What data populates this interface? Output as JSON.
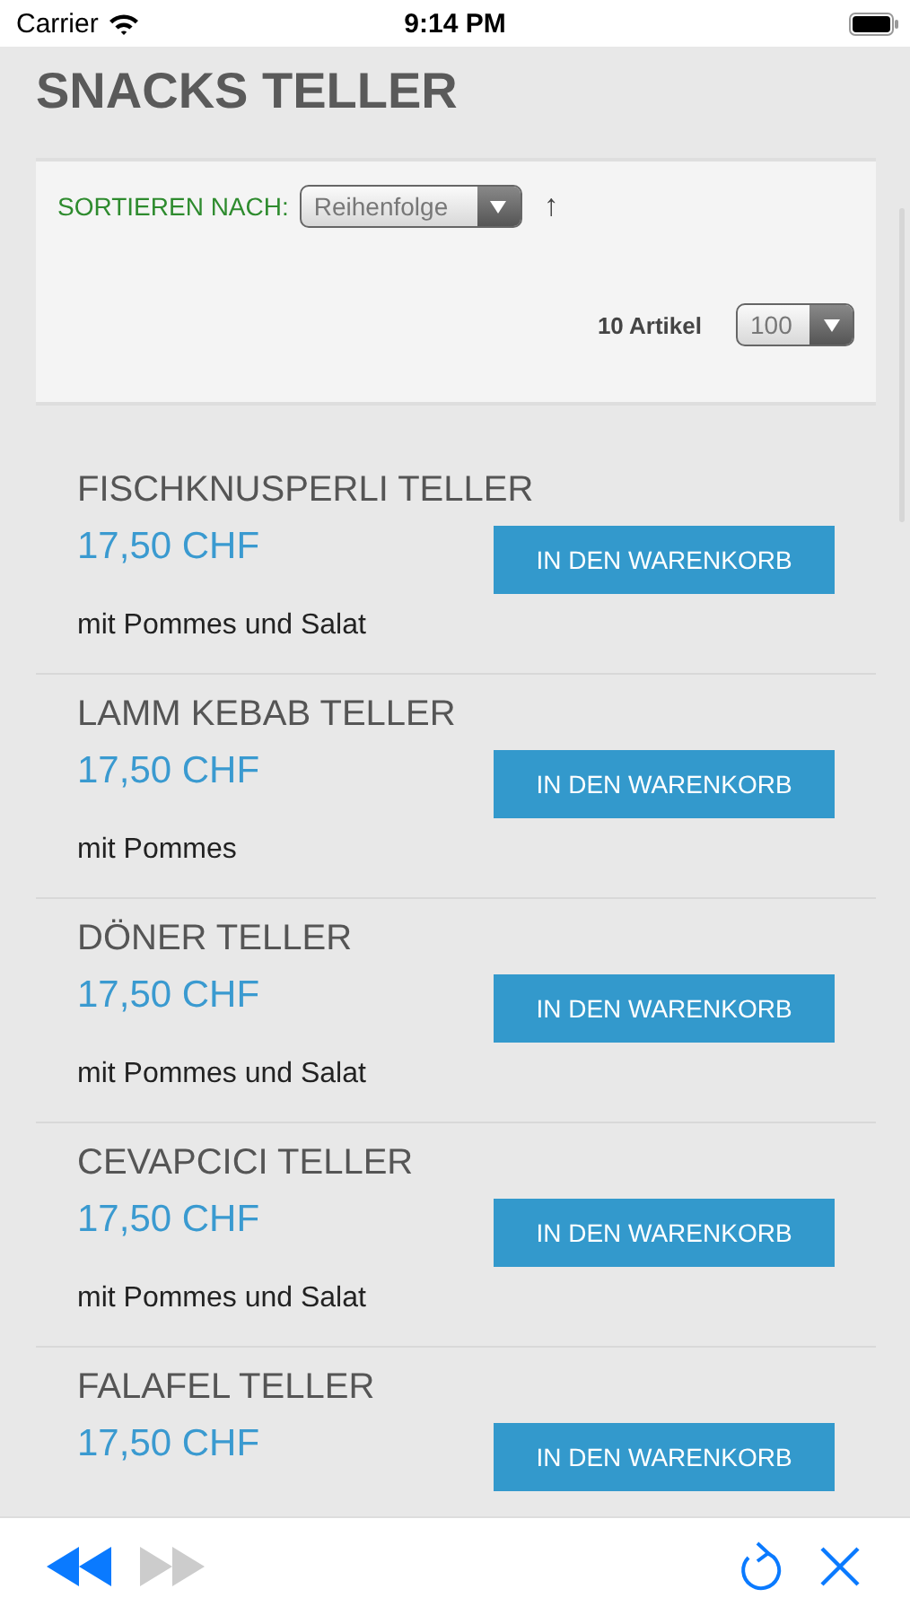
{
  "status_bar": {
    "carrier": "Carrier",
    "time": "9:14 PM"
  },
  "page": {
    "title": "SNACKS TELLER"
  },
  "toolbar": {
    "sort_label": "SORTIEREN NACH:",
    "sort_select": "Reihenfolge",
    "sort_direction": "↑",
    "count": "10 Artikel",
    "per_page_select": "100"
  },
  "products": [
    {
      "name": "FISCHKNUSPERLI TELLER",
      "price": "17,50 CHF",
      "button": "IN DEN WARENKORB",
      "description": "mit Pommes und Salat"
    },
    {
      "name": "LAMM KEBAB TELLER",
      "price": "17,50 CHF",
      "button": "IN DEN WARENKORB",
      "description": "mit Pommes"
    },
    {
      "name": "DÖNER TELLER",
      "price": "17,50 CHF",
      "button": "IN DEN WARENKORB",
      "description": "mit Pommes und Salat"
    },
    {
      "name": "CEVAPCICI TELLER",
      "price": "17,50 CHF",
      "button": "IN DEN WARENKORB",
      "description": "mit Pommes und Salat"
    },
    {
      "name": "FALAFEL TELLER",
      "price": "17,50 CHF",
      "button": "IN DEN WARENKORB"
    }
  ],
  "browser_toolbar": {
    "back": {
      "disabled": false
    },
    "forward": {
      "disabled": true
    }
  }
}
